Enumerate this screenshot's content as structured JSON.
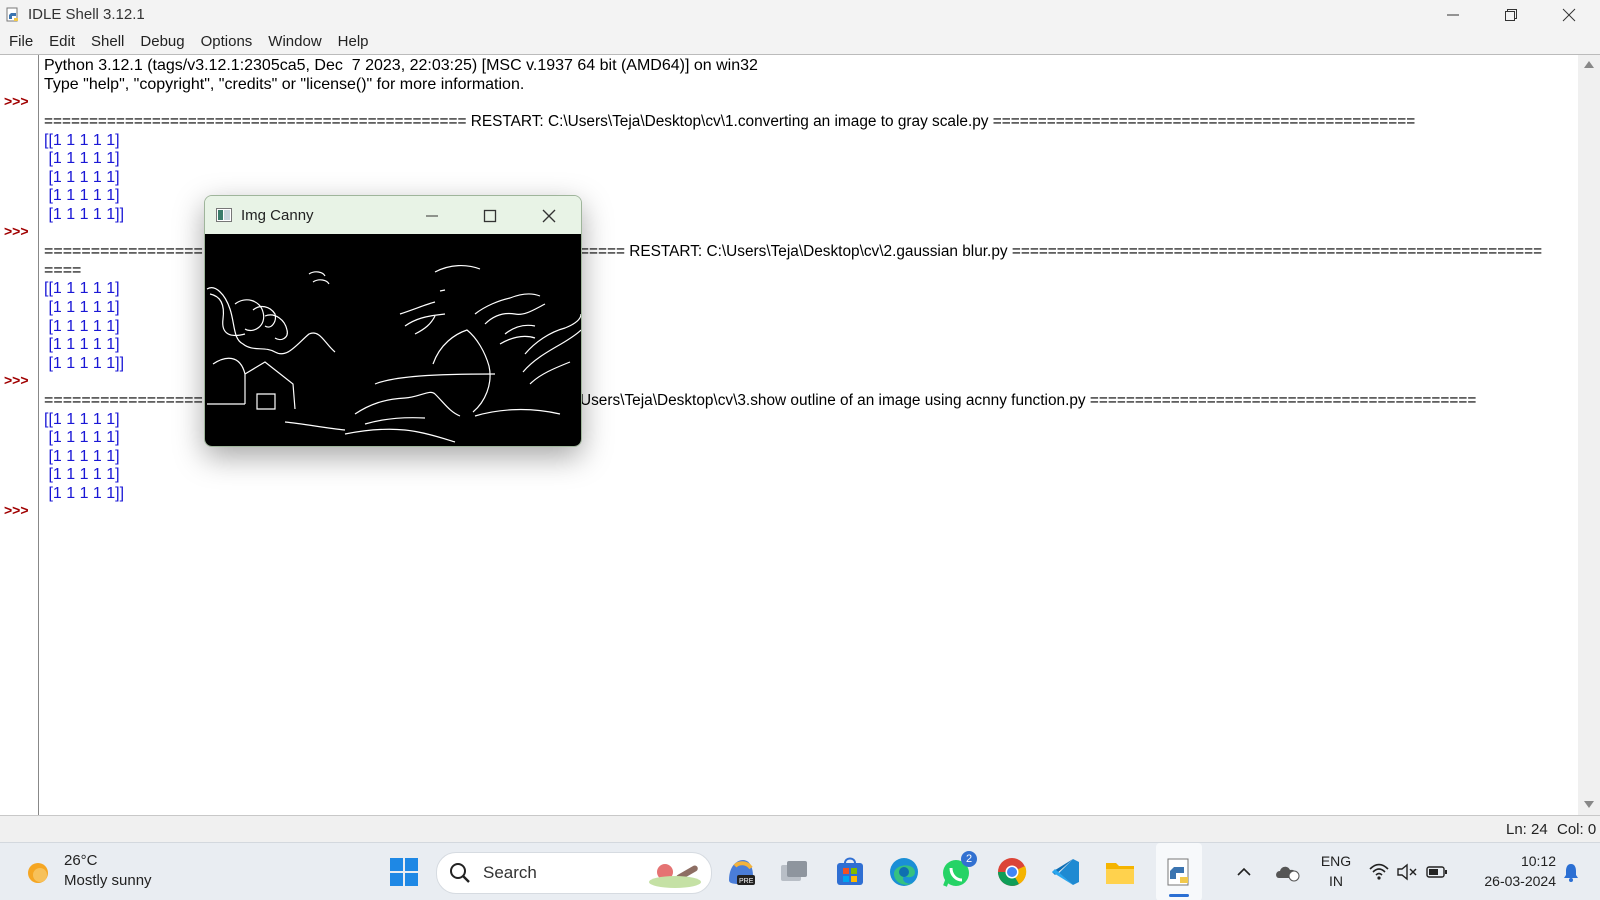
{
  "window": {
    "title": "IDLE Shell 3.12.1"
  },
  "menu": [
    "File",
    "Edit",
    "Shell",
    "Debug",
    "Options",
    "Window",
    "Help"
  ],
  "shell": {
    "banner_line1": "Python 3.12.1 (tags/v3.12.1:2305ca5, Dec  7 2023, 22:03:25) [MSC v.1937 64 bit (AMD64)] on win32",
    "banner_line2": "Type \"help\", \"copyright\", \"credits\" or \"license()\" for more information.",
    "prompt": ">>>",
    "restart1": "=============================================== RESTART: C:\\Users\\Teja\\Desktop\\cv\\1.converting an image to gray scale.py ===============================================",
    "restart2_left": "=================",
    "restart2_right": "===== RESTART: C:\\Users\\Teja\\Desktop\\cv\\2.gaussian blur.py ===========================================================",
    "restart2_wrap": "====",
    "restart3_left": "=================",
    "restart3_right": "Users\\Teja\\Desktop\\cv\\3.show outline of an image using acnny function.py ===========================================",
    "matrix_first": "[[1 1 1 1 1]",
    "matrix_mid": " [1 1 1 1 1]",
    "matrix_last": " [1 1 1 1 1]]"
  },
  "status": {
    "line": "Ln: 24",
    "col": "Col: 0"
  },
  "canny_window": {
    "title": "Img Canny"
  },
  "taskbar": {
    "weather_temp": "26°C",
    "weather_desc": "Mostly sunny",
    "search_label": "Search",
    "whatsapp_badge": "2",
    "lang_line1": "ENG",
    "lang_line2": "IN",
    "time": "10:12",
    "date": "26-03-2024"
  },
  "colors": {
    "output_blue": "#1a17d6",
    "prompt_red": "#a00000",
    "canny_title_bg": "#e8f3e6"
  }
}
